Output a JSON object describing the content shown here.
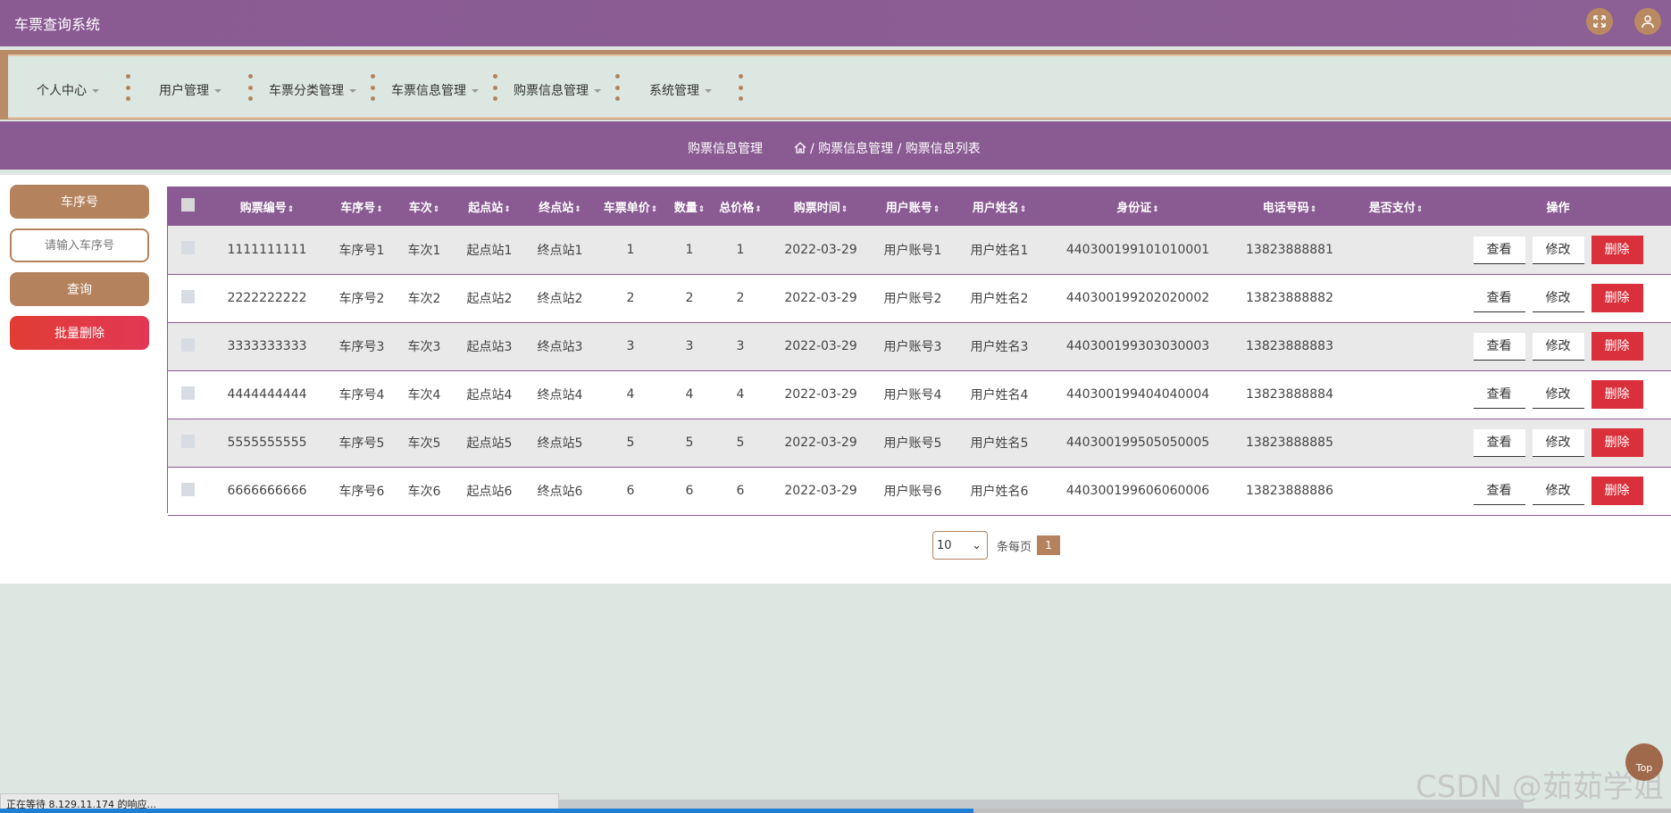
{
  "header": {
    "title": "车票查询系统"
  },
  "nav": {
    "items": [
      {
        "label": "个人中心"
      },
      {
        "label": "用户管理"
      },
      {
        "label": "车票分类管理"
      },
      {
        "label": "车票信息管理"
      },
      {
        "label": "购票信息管理"
      },
      {
        "label": "系统管理"
      }
    ]
  },
  "breadcrumb": {
    "title": "购票信息管理",
    "path": "/ 购票信息管理 / 购票信息列表"
  },
  "sidebar": {
    "field_label": "车序号",
    "input_placeholder": "请输入车序号",
    "search_label": "查询",
    "batch_delete_label": "批量删除"
  },
  "table": {
    "columns": [
      "购票编号",
      "车序号",
      "车次",
      "起点站",
      "终点站",
      "车票单价",
      "数量",
      "总价格",
      "购票时间",
      "用户账号",
      "用户姓名",
      "身份证",
      "电话号码",
      "是否支付",
      "操作"
    ],
    "actions": {
      "view": "查看",
      "edit": "修改",
      "delete": "删除"
    },
    "rows": [
      [
        "1111111111",
        "车序号1",
        "车次1",
        "起点站1",
        "终点站1",
        "1",
        "1",
        "1",
        "2022-03-29",
        "用户账号1",
        "用户姓名1",
        "440300199101010001",
        "13823888881",
        ""
      ],
      [
        "2222222222",
        "车序号2",
        "车次2",
        "起点站2",
        "终点站2",
        "2",
        "2",
        "2",
        "2022-03-29",
        "用户账号2",
        "用户姓名2",
        "440300199202020002",
        "13823888882",
        ""
      ],
      [
        "3333333333",
        "车序号3",
        "车次3",
        "起点站3",
        "终点站3",
        "3",
        "3",
        "3",
        "2022-03-29",
        "用户账号3",
        "用户姓名3",
        "440300199303030003",
        "13823888883",
        ""
      ],
      [
        "4444444444",
        "车序号4",
        "车次4",
        "起点站4",
        "终点站4",
        "4",
        "4",
        "4",
        "2022-03-29",
        "用户账号4",
        "用户姓名4",
        "440300199404040004",
        "13823888884",
        ""
      ],
      [
        "5555555555",
        "车序号5",
        "车次5",
        "起点站5",
        "终点站5",
        "5",
        "5",
        "5",
        "2022-03-29",
        "用户账号5",
        "用户姓名5",
        "440300199505050005",
        "13823888885",
        ""
      ],
      [
        "6666666666",
        "车序号6",
        "车次6",
        "起点站6",
        "终点站6",
        "6",
        "6",
        "6",
        "2022-03-29",
        "用户账号6",
        "用户姓名6",
        "440300199606060006",
        "13823888886",
        ""
      ]
    ]
  },
  "pagination": {
    "page_size": "10",
    "per_page_label": "条每页",
    "current_page": "1"
  },
  "back_to_top": "Top",
  "status_text": "正在等待 8.129.11.174 的响应...",
  "watermark": "CSDN @茹茹学姐",
  "colors": {
    "primary": "#8a5a93",
    "accent": "#b4835e",
    "danger": "#d9303b",
    "background": "#dde7e2"
  }
}
